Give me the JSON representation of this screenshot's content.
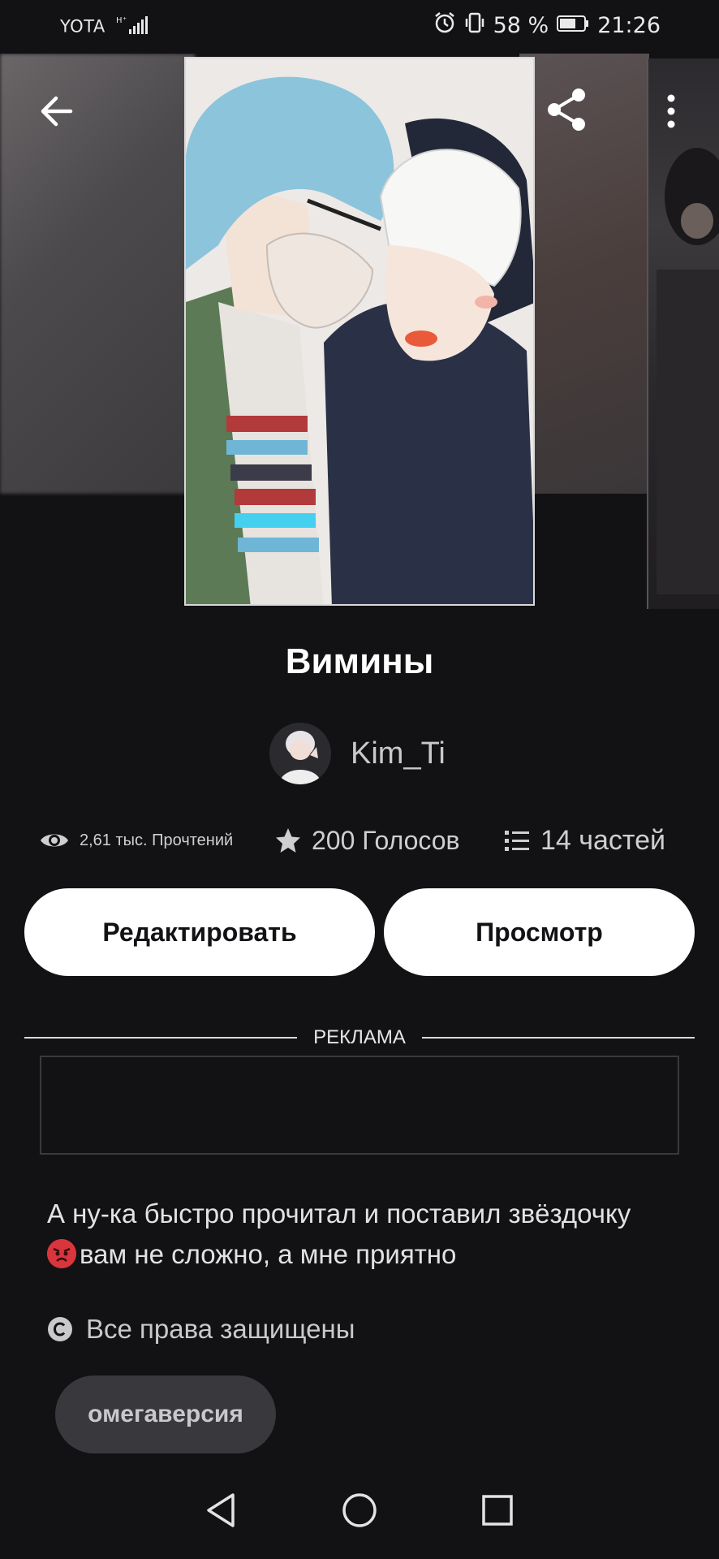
{
  "status_bar": {
    "carrier": "YOTA",
    "network": "H⁺",
    "battery": "58 %",
    "time": "21:26"
  },
  "header": {
    "back_icon": "arrow-left-icon",
    "share_icon": "share-icon",
    "more_icon": "more-vertical-icon"
  },
  "story": {
    "title": "Вимины",
    "author": "Kim_Ti",
    "reads": "2,61 тыс. Прочтений",
    "votes": "200 Голосов",
    "parts": "14 частей",
    "description_line1": "А ну-ка быстро прочитал и поставил звёздочку",
    "description_line2": "вам не сложно, а мне приятно",
    "copyright": "Все права защищены",
    "tag": "омегаверсия"
  },
  "actions": {
    "edit_label": "Редактировать",
    "view_label": "Просмотр"
  },
  "ad": {
    "label": "РЕКЛАМА"
  },
  "colors": {
    "background": "#121114",
    "button_bg": "#ffffff",
    "tag_bg": "#39383c",
    "muted_text": "#c9c9cc"
  }
}
